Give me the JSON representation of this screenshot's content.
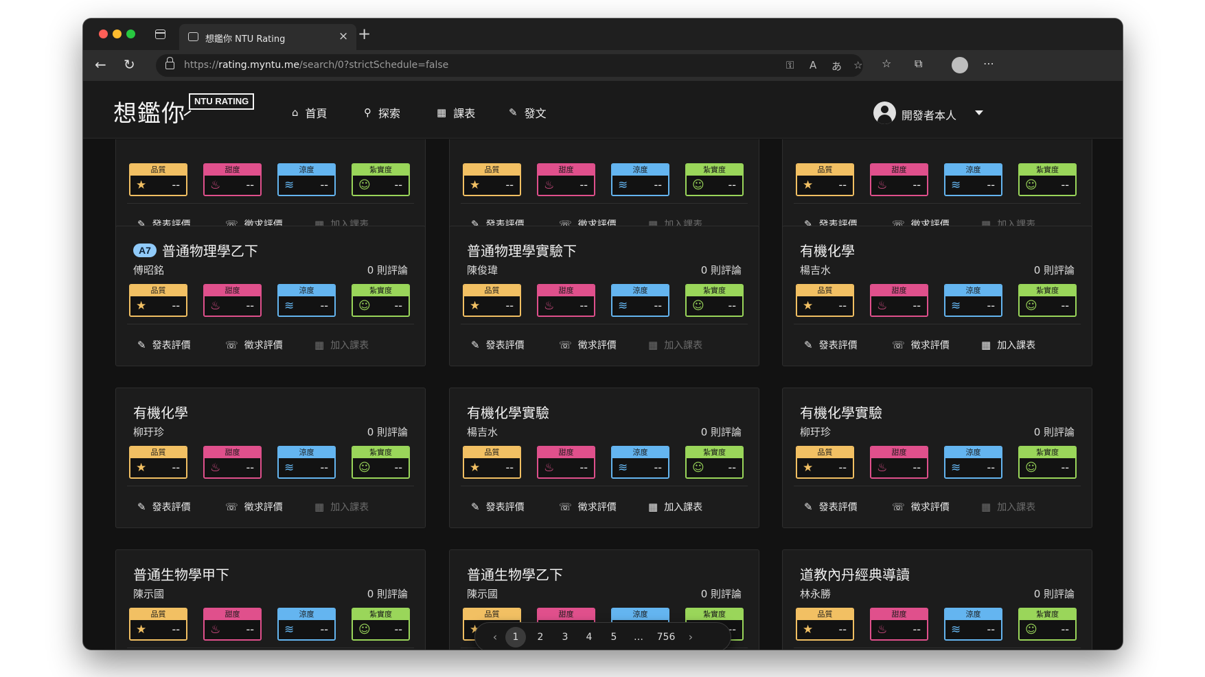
{
  "browser": {
    "tab_title": "想鑑你 NTU Rating",
    "url_host": "rating.myntu.me",
    "url_prefix": "https://",
    "url_path": "/search/0?strictSchedule=false",
    "new_tab": "+",
    "tab_close": "×"
  },
  "header": {
    "logo_text": "想鑑你",
    "logo_badge": "NTU RATING",
    "nav": [
      {
        "label": "首頁",
        "icon": "home-icon"
      },
      {
        "label": "探索",
        "icon": "search-icon"
      },
      {
        "label": "課表",
        "icon": "table-icon"
      },
      {
        "label": "發文",
        "icon": "pencil-icon"
      }
    ],
    "user_name": "開發者本人"
  },
  "metric_labels": {
    "quality": "品質",
    "sweetness": "甜度",
    "coolness": "涼度",
    "solidness": "紮實度"
  },
  "metric_empty": "--",
  "actions": {
    "post": "發表評價",
    "request": "徵求評價",
    "add": "加入課表"
  },
  "cards": [
    {
      "tag": "",
      "name": "",
      "teacher": "",
      "reviews": "",
      "add_enabled": false
    },
    {
      "tag": "",
      "name": "",
      "teacher": "",
      "reviews": "",
      "add_enabled": false
    },
    {
      "tag": "",
      "name": "",
      "teacher": "",
      "reviews": "",
      "add_enabled": false
    },
    {
      "tag": "A7",
      "name": "普通物理學乙下",
      "teacher": "傅昭銘",
      "reviews": "0 則評論",
      "add_enabled": false
    },
    {
      "tag": "",
      "name": "普通物理學實驗下",
      "teacher": "陳俊瑋",
      "reviews": "0 則評論",
      "add_enabled": false
    },
    {
      "tag": "",
      "name": "有機化學",
      "teacher": "楊吉水",
      "reviews": "0 則評論",
      "add_enabled": true
    },
    {
      "tag": "",
      "name": "有機化學",
      "teacher": "柳玗珍",
      "reviews": "0 則評論",
      "add_enabled": false
    },
    {
      "tag": "",
      "name": "有機化學實驗",
      "teacher": "楊吉水",
      "reviews": "0 則評論",
      "add_enabled": true
    },
    {
      "tag": "",
      "name": "有機化學實驗",
      "teacher": "柳玗珍",
      "reviews": "0 則評論",
      "add_enabled": false
    },
    {
      "tag": "",
      "name": "普通生物學甲下",
      "teacher": "陳示國",
      "reviews": "0 則評論",
      "add_enabled": false
    },
    {
      "tag": "",
      "name": "普通生物學乙下",
      "teacher": "陳示國",
      "reviews": "0 則評論",
      "add_enabled": false
    },
    {
      "tag": "",
      "name": "道教內丹經典導讀",
      "teacher": "林永勝",
      "reviews": "0 則評論",
      "add_enabled": false
    }
  ],
  "pagination": {
    "prev": "‹",
    "pages": [
      "1",
      "2",
      "3",
      "4",
      "5",
      "…",
      "756"
    ],
    "current": "1",
    "next": "›"
  },
  "colors": {
    "quality": "#f2c063",
    "sweetness": "#e0508c",
    "coolness": "#64b5f0",
    "solidness": "#9ad65a",
    "tag": "#90caf9"
  }
}
